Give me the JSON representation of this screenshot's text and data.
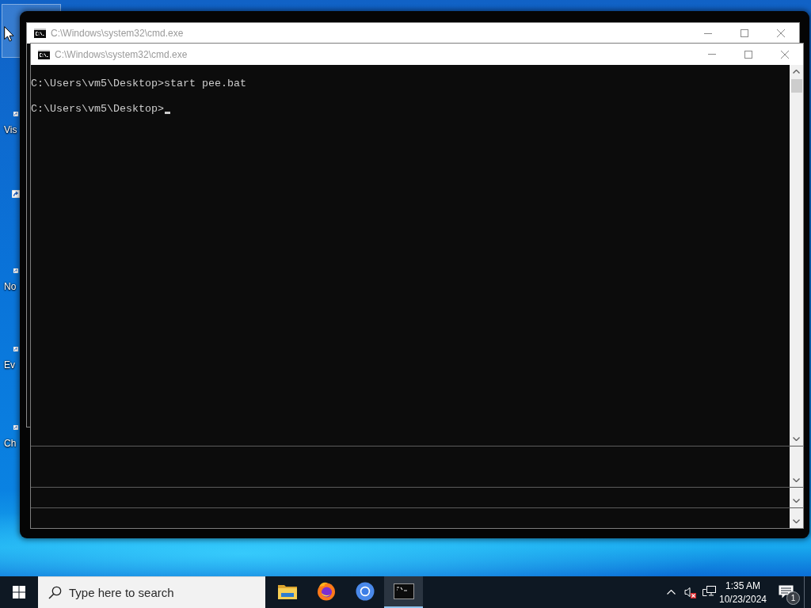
{
  "desktop": {
    "icons": [
      {
        "selected": true,
        "shortcut": false
      },
      {
        "label": "Vis",
        "selected": false,
        "shortcut": true
      },
      {
        "selected": false,
        "shortcut": true
      },
      {
        "label": "No",
        "selected": false,
        "shortcut": true
      },
      {
        "label": "Ev",
        "selected": false,
        "shortcut": true
      },
      {
        "label": "Ch",
        "selected": false,
        "shortcut": true
      }
    ]
  },
  "windows": [
    {
      "title": "C:\\Windows\\system32\\cmd.exe"
    },
    {
      "title": "C:\\Windows\\system32\\cmd.exe",
      "lines": [
        {
          "text": "C:\\Users\\vm5\\Desktop>start pee.bat",
          "cursor": false
        },
        {
          "text": "C:\\Users\\vm5\\Desktop>",
          "cursor": true
        }
      ]
    }
  ],
  "taskbar": {
    "search": {
      "placeholder": "Type here to search"
    },
    "apps": [
      {
        "kind": "folder",
        "selected": false
      },
      {
        "kind": "flame",
        "selected": false
      },
      {
        "kind": "ring",
        "selected": false
      },
      {
        "kind": "terminal",
        "selected": true
      }
    ],
    "tray": {
      "volume": {
        "muted": true
      },
      "clock": {
        "time": "1:35 AM",
        "date": "10/23/2024"
      },
      "notifications": {
        "count": "1"
      }
    }
  }
}
